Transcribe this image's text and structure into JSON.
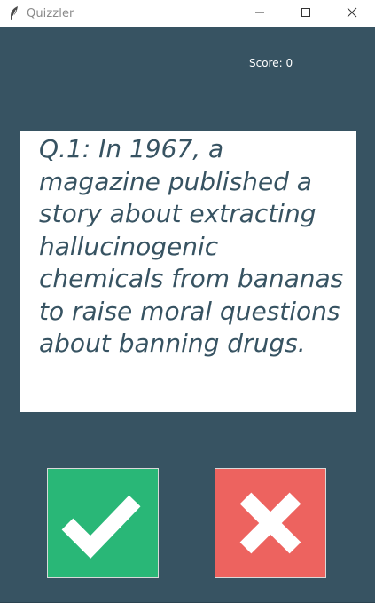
{
  "window": {
    "title": "Quizzler",
    "icon": "feather-icon",
    "controls": [
      "minimize-icon",
      "maximize-icon",
      "close-icon"
    ]
  },
  "score": {
    "label": "Score: 0"
  },
  "question": {
    "text": "Q.1: In 1967, a magazine published a story about extracting hallucinogenic chemicals from bananas to raise moral questions about banning drugs."
  },
  "buttons": {
    "true_icon": "checkmark-icon",
    "false_icon": "cross-icon"
  },
  "colors": {
    "theme": "#375362",
    "true_button": "#29b777",
    "false_button": "#ed635f",
    "card": "#ffffff",
    "question_text": "#375362"
  }
}
